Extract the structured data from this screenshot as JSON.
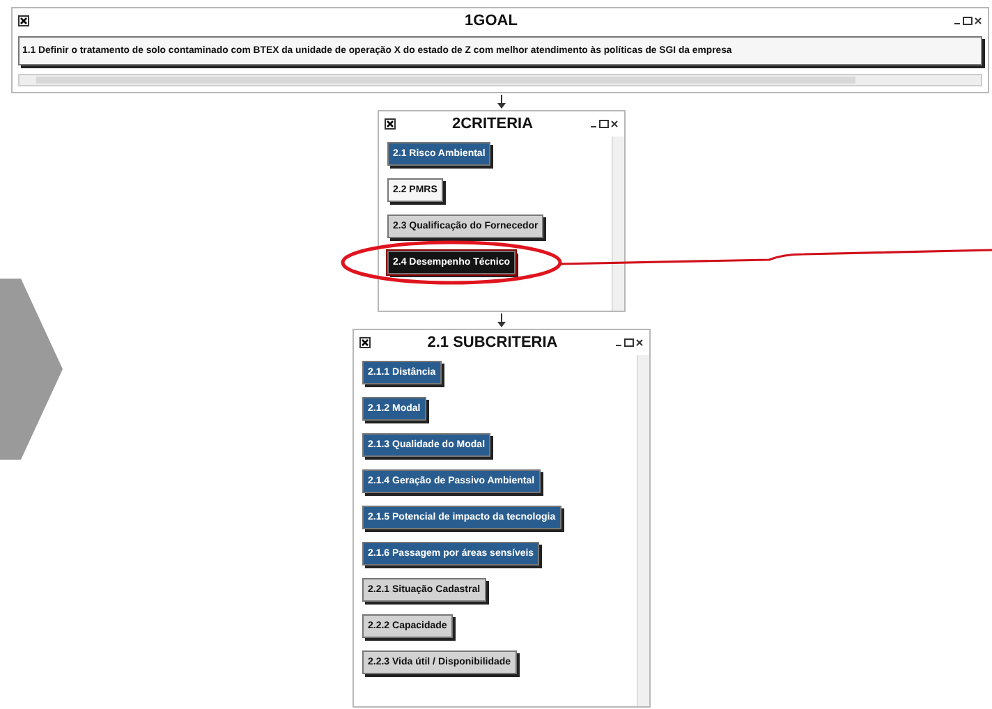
{
  "goal": {
    "title": "1GOAL",
    "items": [
      {
        "label": "1.1 Definir o tratamento de solo contaminado com BTEX da unidade de operação X do estado de Z com melhor atendimento às políticas de SGI da empresa",
        "kind": "white",
        "highlighted": false
      }
    ]
  },
  "criteria": {
    "title": "2CRITERIA",
    "items": [
      {
        "label": "2.1 Risco Ambiental",
        "kind": "blue",
        "highlighted": false
      },
      {
        "label": "2.2 PMRS",
        "kind": "white",
        "highlighted": false
      },
      {
        "label": "2.3 Qualificação do Fornecedor",
        "kind": "grey",
        "highlighted": false
      },
      {
        "label": "2.4 Desempenho Técnico",
        "kind": "black",
        "highlighted": true
      }
    ]
  },
  "subcriteria": {
    "title": "2.1 SUBCRITERIA",
    "items": [
      {
        "label": "2.1.1  Distância",
        "kind": "blue",
        "highlighted": false
      },
      {
        "label": "2.1.2 Modal",
        "kind": "blue",
        "highlighted": false
      },
      {
        "label": "2.1.3 Qualidade do Modal",
        "kind": "blue",
        "highlighted": false
      },
      {
        "label": "2.1.4 Geração de Passivo Ambiental",
        "kind": "blue",
        "highlighted": false
      },
      {
        "label": "2.1.5 Potencial de impacto da tecnologia",
        "kind": "blue",
        "highlighted": false
      },
      {
        "label": "2.1.6 Passagem por áreas sensíveis",
        "kind": "blue",
        "highlighted": false
      },
      {
        "label": "2.2.1  Situação Cadastral",
        "kind": "grey",
        "highlighted": false
      },
      {
        "label": "2.2.2 Capacidade",
        "kind": "grey",
        "highlighted": false
      },
      {
        "label": "2.2.3 Vida útil / Disponibilidade",
        "kind": "grey",
        "highlighted": false
      }
    ]
  }
}
